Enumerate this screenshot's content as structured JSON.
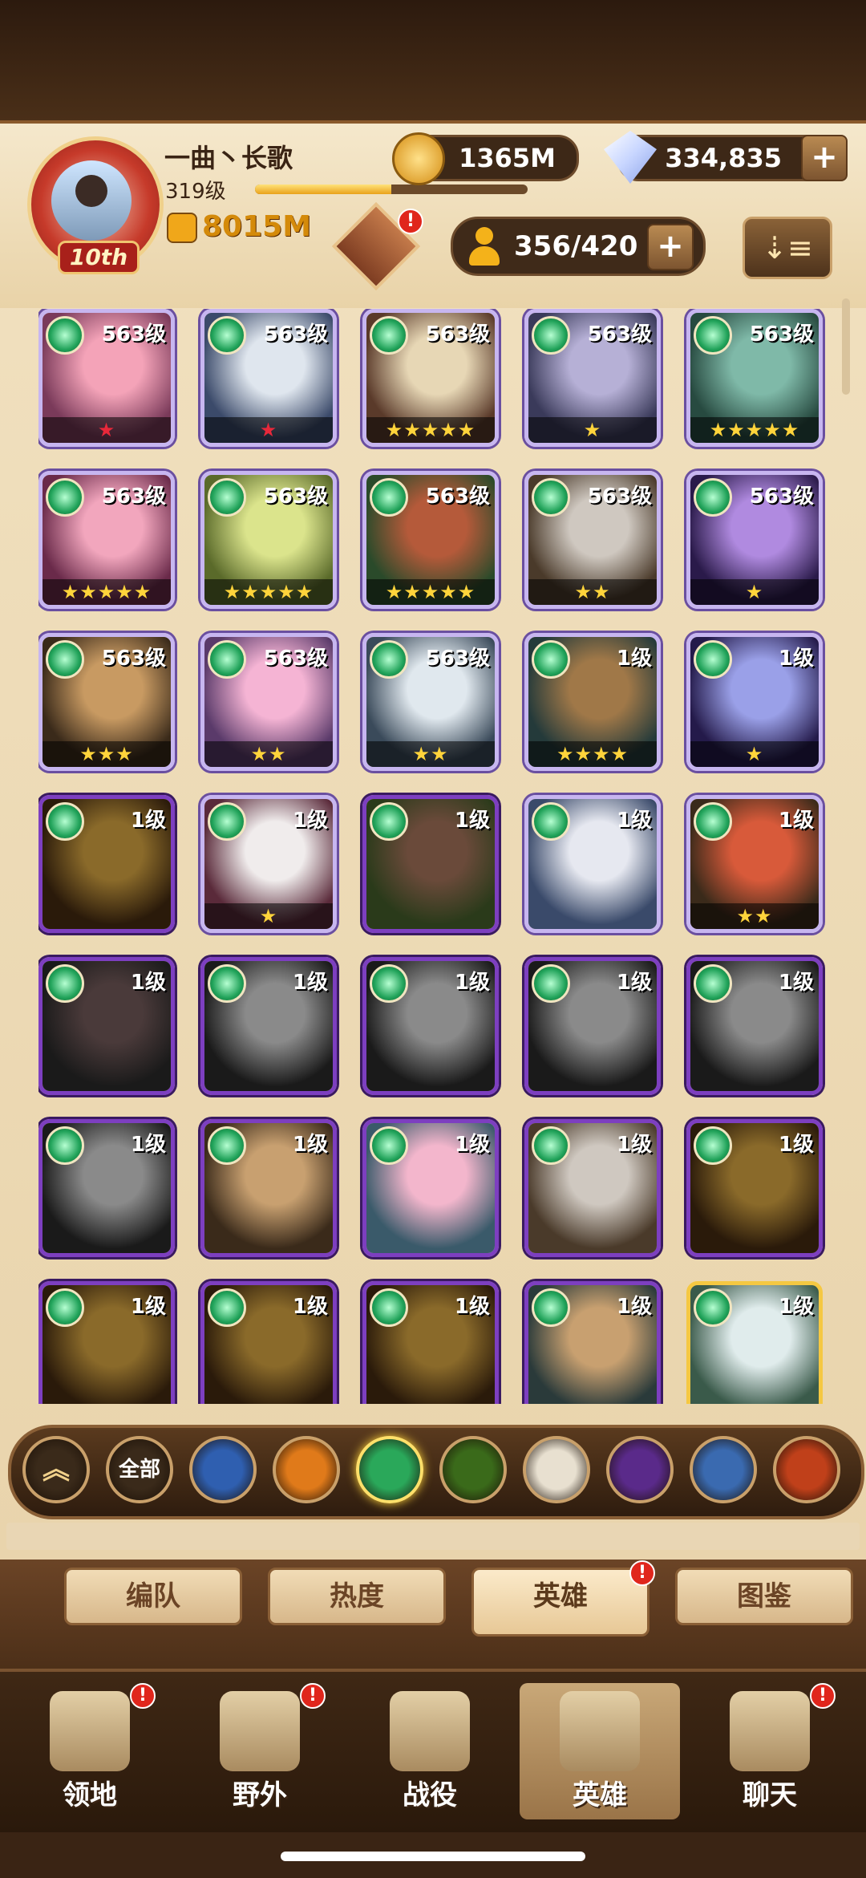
{
  "player": {
    "name": "一曲丶长歌",
    "level": "319级",
    "rank": "10th",
    "power": "8015M",
    "xp_fraction": 0.5
  },
  "currency": {
    "gold": "1365M",
    "gems": "334,835"
  },
  "hero_count": "356/420",
  "emblem_badge": "!",
  "heroes": [
    {
      "level": "563级",
      "stars": "★",
      "star_color": "red"
    },
    {
      "level": "563级",
      "stars": "★",
      "star_color": "red"
    },
    {
      "level": "563级",
      "stars": "★★★★★",
      "star_color": "gold"
    },
    {
      "level": "563级",
      "stars": "★",
      "star_color": "gold"
    },
    {
      "level": "563级",
      "stars": "★★★★★",
      "star_color": "gold"
    },
    {
      "level": "563级",
      "stars": "★★★★★",
      "star_color": "gold"
    },
    {
      "level": "563级",
      "stars": "★★★★★",
      "star_color": "gold"
    },
    {
      "level": "563级",
      "stars": "★★★★★",
      "star_color": "gold"
    },
    {
      "level": "563级",
      "stars": "★★",
      "star_color": "gold"
    },
    {
      "level": "563级",
      "stars": "★",
      "star_color": "gold"
    },
    {
      "level": "563级",
      "stars": "★★★",
      "star_color": "gold"
    },
    {
      "level": "563级",
      "stars": "★★",
      "star_color": "gold"
    },
    {
      "level": "563级",
      "stars": "★★",
      "star_color": "gold"
    },
    {
      "level": "1级",
      "stars": "★★★★",
      "star_color": "gold"
    },
    {
      "level": "1级",
      "stars": "★",
      "star_color": "gold"
    },
    {
      "level": "1级",
      "stars": "",
      "star_color": "gold"
    },
    {
      "level": "1级",
      "stars": "★",
      "star_color": "gold"
    },
    {
      "level": "1级",
      "stars": "",
      "star_color": "gold"
    },
    {
      "level": "1级",
      "stars": "",
      "star_color": "gold"
    },
    {
      "level": "1级",
      "stars": "★★",
      "star_color": "gold"
    },
    {
      "level": "1级",
      "stars": "",
      "star_color": "gold"
    },
    {
      "level": "1级",
      "stars": "",
      "star_color": "gold"
    },
    {
      "level": "1级",
      "stars": "",
      "star_color": "gold"
    },
    {
      "level": "1级",
      "stars": "",
      "star_color": "gold"
    },
    {
      "level": "1级",
      "stars": "",
      "star_color": "gold"
    },
    {
      "level": "1级",
      "stars": "",
      "star_color": "gold"
    },
    {
      "level": "1级",
      "stars": "",
      "star_color": "gold"
    },
    {
      "level": "1级",
      "stars": "",
      "star_color": "gold"
    },
    {
      "level": "1级",
      "stars": "",
      "star_color": "gold"
    },
    {
      "level": "1级",
      "stars": "",
      "star_color": "gold"
    },
    {
      "level": "1级",
      "stars": "",
      "star_color": "gold"
    },
    {
      "level": "1级",
      "stars": "",
      "star_color": "gold"
    },
    {
      "level": "1级",
      "stars": "",
      "star_color": "gold"
    },
    {
      "level": "1级",
      "stars": "",
      "star_color": "gold"
    },
    {
      "level": "1级",
      "stars": "",
      "star_color": "gold"
    }
  ],
  "faction_filters": [
    {
      "label": "",
      "icon": "chevron-up-icon"
    },
    {
      "label": "全部",
      "icon": "all-icon"
    },
    {
      "label": "",
      "icon": "lightbearer-icon"
    },
    {
      "label": "",
      "icon": "mauler-icon"
    },
    {
      "label": "",
      "icon": "wilder-icon"
    },
    {
      "label": "",
      "icon": "graveborn-icon"
    },
    {
      "label": "",
      "icon": "celestial-icon"
    },
    {
      "label": "",
      "icon": "hypogean-icon"
    },
    {
      "label": "",
      "icon": "dimensional-icon"
    },
    {
      "label": "",
      "icon": "dragon-icon"
    }
  ],
  "tabs": [
    {
      "label": "编队",
      "badge": ""
    },
    {
      "label": "热度",
      "badge": ""
    },
    {
      "label": "英雄",
      "badge": "!"
    },
    {
      "label": "图鉴",
      "badge": ""
    }
  ],
  "nav": [
    {
      "label": "领地",
      "badge": "!"
    },
    {
      "label": "野外",
      "badge": "!"
    },
    {
      "label": "战役",
      "badge": ""
    },
    {
      "label": "英雄",
      "badge": ""
    },
    {
      "label": "聊天",
      "badge": "!"
    }
  ],
  "colors": {
    "gold_star": "#ffd43b",
    "red_star": "#e8283a",
    "badge": "#e0261c"
  }
}
